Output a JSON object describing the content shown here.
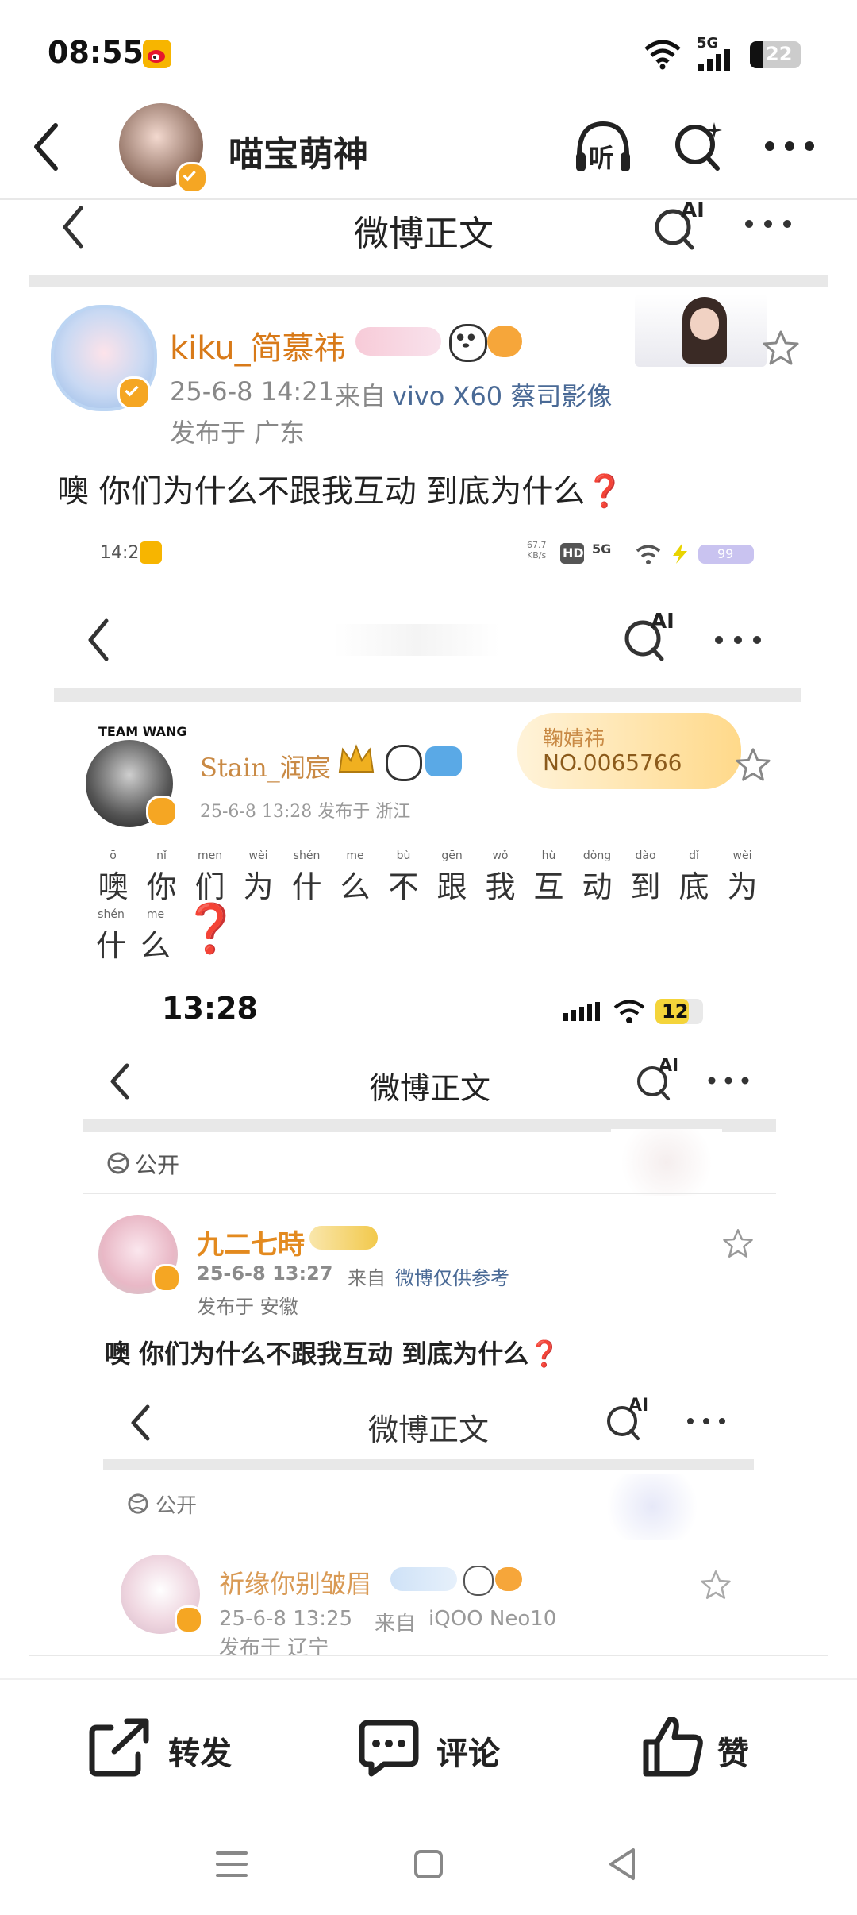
{
  "status_bar": {
    "time": "08:55",
    "network_label": "5G",
    "battery": "22"
  },
  "header": {
    "title": "喵宝萌神",
    "listen_label": "听"
  },
  "post_header": {
    "title": "微博正文",
    "ai_label": "AI"
  },
  "post": {
    "username": "kiku_简慕祎",
    "time": "25-6-8 14:21",
    "from_prefix": "来自",
    "source": "vivo X60 蔡司影像",
    "location": "发布于 广东",
    "text": "噢 你们为什么不跟我互动 到底为什么❓"
  },
  "shot1": {
    "time": "14:21",
    "speed": "67.7 KB/s",
    "hd": "HD",
    "network": "5G",
    "battery": "99",
    "ai_label": "AI",
    "team": "TEAM WANG",
    "username": "Stain_润宸",
    "meta": "25-6-8 13:28  发布于 浙江",
    "card_name": "鞠婧祎",
    "card_no": "NO.0065766",
    "chars_line1": [
      "噢",
      "你",
      "们",
      "为",
      "什",
      "么",
      "不",
      "跟",
      "我",
      "互",
      "动",
      "到",
      "底",
      "为"
    ],
    "pinyin_line1": [
      "ō",
      "nǐ",
      "men",
      "wèi",
      "shén",
      "me",
      "bù",
      "gēn",
      "wǒ",
      "hù",
      "dòng",
      "dào",
      "dǐ",
      "wèi"
    ],
    "chars_line2": [
      "什",
      "么"
    ],
    "pinyin_line2": [
      "shén",
      "me"
    ],
    "mark": "❓"
  },
  "shot2": {
    "time": "13:28",
    "battery": "12",
    "title": "微博正文",
    "ai_label": "AI",
    "public_label": "公开",
    "username": "九二七時",
    "time_posted": "25-6-8 13:27",
    "from_prefix": "来自",
    "source": "微博仅供参考",
    "location": "发布于 安徽",
    "text": "噢 你们为什么不跟我互动 到底为什么❓"
  },
  "shot3": {
    "title": "微博正文",
    "ai_label": "AI",
    "public_label": "公开",
    "username": "祈缘你别皱眉",
    "time_posted": "25-6-8 13:25",
    "from_prefix": "来自",
    "source": "iQOO Neo10",
    "location": "发布于 辽宁"
  },
  "bottom_bar": {
    "repost": "转发",
    "comment": "评论",
    "like": "赞"
  },
  "colors": {
    "accent_orange": "#d87a19",
    "verified_gold": "#f5a623",
    "link_blue": "#4a6a96",
    "question_red": "#e0313a"
  }
}
